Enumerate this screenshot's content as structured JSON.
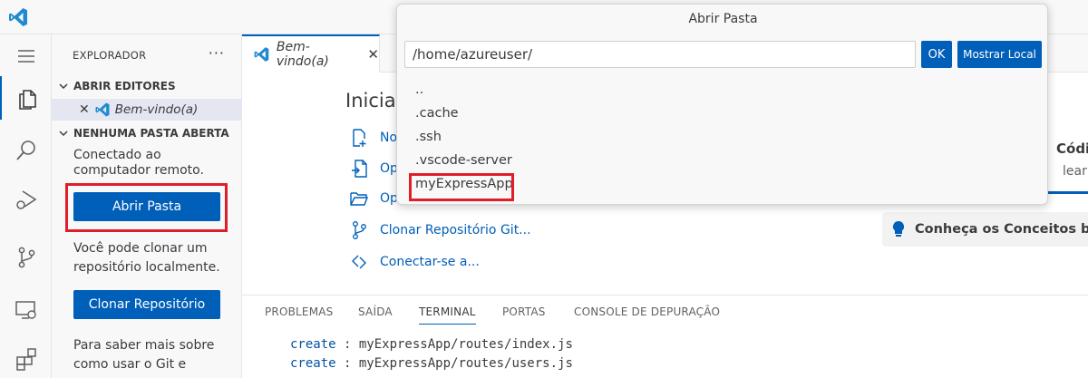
{
  "explorer": {
    "title": "EXPLORADOR",
    "more": "···",
    "open_editors_label": "ABRIR EDITORES",
    "open_editor_item": "Bem-vindo(a)",
    "close_glyph": "✕",
    "no_folder_label": "NENHUMA PASTA ABERTA",
    "connected_text": "Conectado ao computador remoto.",
    "open_folder_button": "Abrir Pasta",
    "clone_text": "Você pode clonar um repositório localmente.",
    "clone_button": "Clonar Repositório",
    "learn_text": "Para saber mais sobre como usar o Git e"
  },
  "editor": {
    "tab_label": "Bem-vindo(a)",
    "tab_close": "✕"
  },
  "welcome": {
    "heading": "Iniciar",
    "items": [
      {
        "label": "Novo Arquivo...",
        "icon": "new-file-icon"
      },
      {
        "label": "Open File...",
        "icon": "open-file-icon"
      },
      {
        "label": "Open Folder...",
        "icon": "open-folder-icon"
      },
      {
        "label": "Clonar Repositório Git...",
        "icon": "source-control-icon"
      },
      {
        "label": "Conectar-se a...",
        "icon": "remote-connect-icon"
      }
    ],
    "card_title": "Códi",
    "card_sub": "lear",
    "concept_label": "Conheça os Conceitos bá"
  },
  "panel": {
    "tabs": [
      "PROBLEMAS",
      "SAÍDA",
      "TERMINAL",
      "PORTAS",
      "CONSOLE DE DEPURAÇÃO"
    ],
    "active_tab": "TERMINAL",
    "terminal_lines": [
      {
        "keyword": "create",
        "rest": " : myExpressApp/routes/index.js"
      },
      {
        "keyword": "create",
        "rest": " : myExpressApp/routes/users.js"
      }
    ]
  },
  "quickpick": {
    "title": "Abrir Pasta",
    "input_value": "/home/azureuser/",
    "ok_button": "OK",
    "show_local_button": "Mostrar Local",
    "items": [
      "..",
      ".cache",
      ".ssh",
      ".vscode-server",
      "myExpressApp"
    ],
    "highlighted_item": "myExpressApp"
  },
  "colors": {
    "accent": "#005fb8",
    "highlight": "#e01e28"
  }
}
